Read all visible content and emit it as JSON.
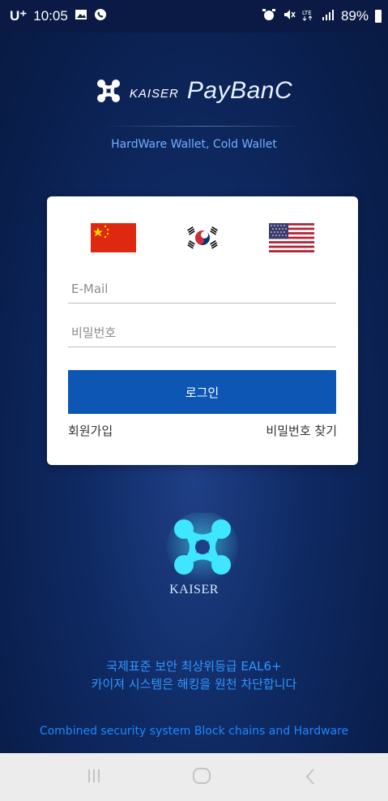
{
  "status_bar": {
    "carrier": "U⁺",
    "time": "10:05",
    "battery": "89%"
  },
  "brand": {
    "kaiser": "KAISER",
    "name": "PayBanC",
    "tagline": "HardWare Wallet, Cold Wallet"
  },
  "login_form": {
    "email_placeholder": "E-Mail",
    "password_placeholder": "비밀번호",
    "login_label": "로그인",
    "signup_label": "회원가입",
    "find_password_label": "비밀번호 찾기"
  },
  "emblem": {
    "label": "KAISER"
  },
  "security": {
    "line1": "국제표준 보안 최상위등급 EAL6+",
    "line2": "카이져 시스템은 해킹을 원천 차단합니다",
    "combined": "Combined security system Block chains and Hardware"
  },
  "colors": {
    "background": "#0f2a63",
    "primary_button": "#0d56b3",
    "accent_text": "#2e97ff",
    "card": "#ffffff"
  }
}
